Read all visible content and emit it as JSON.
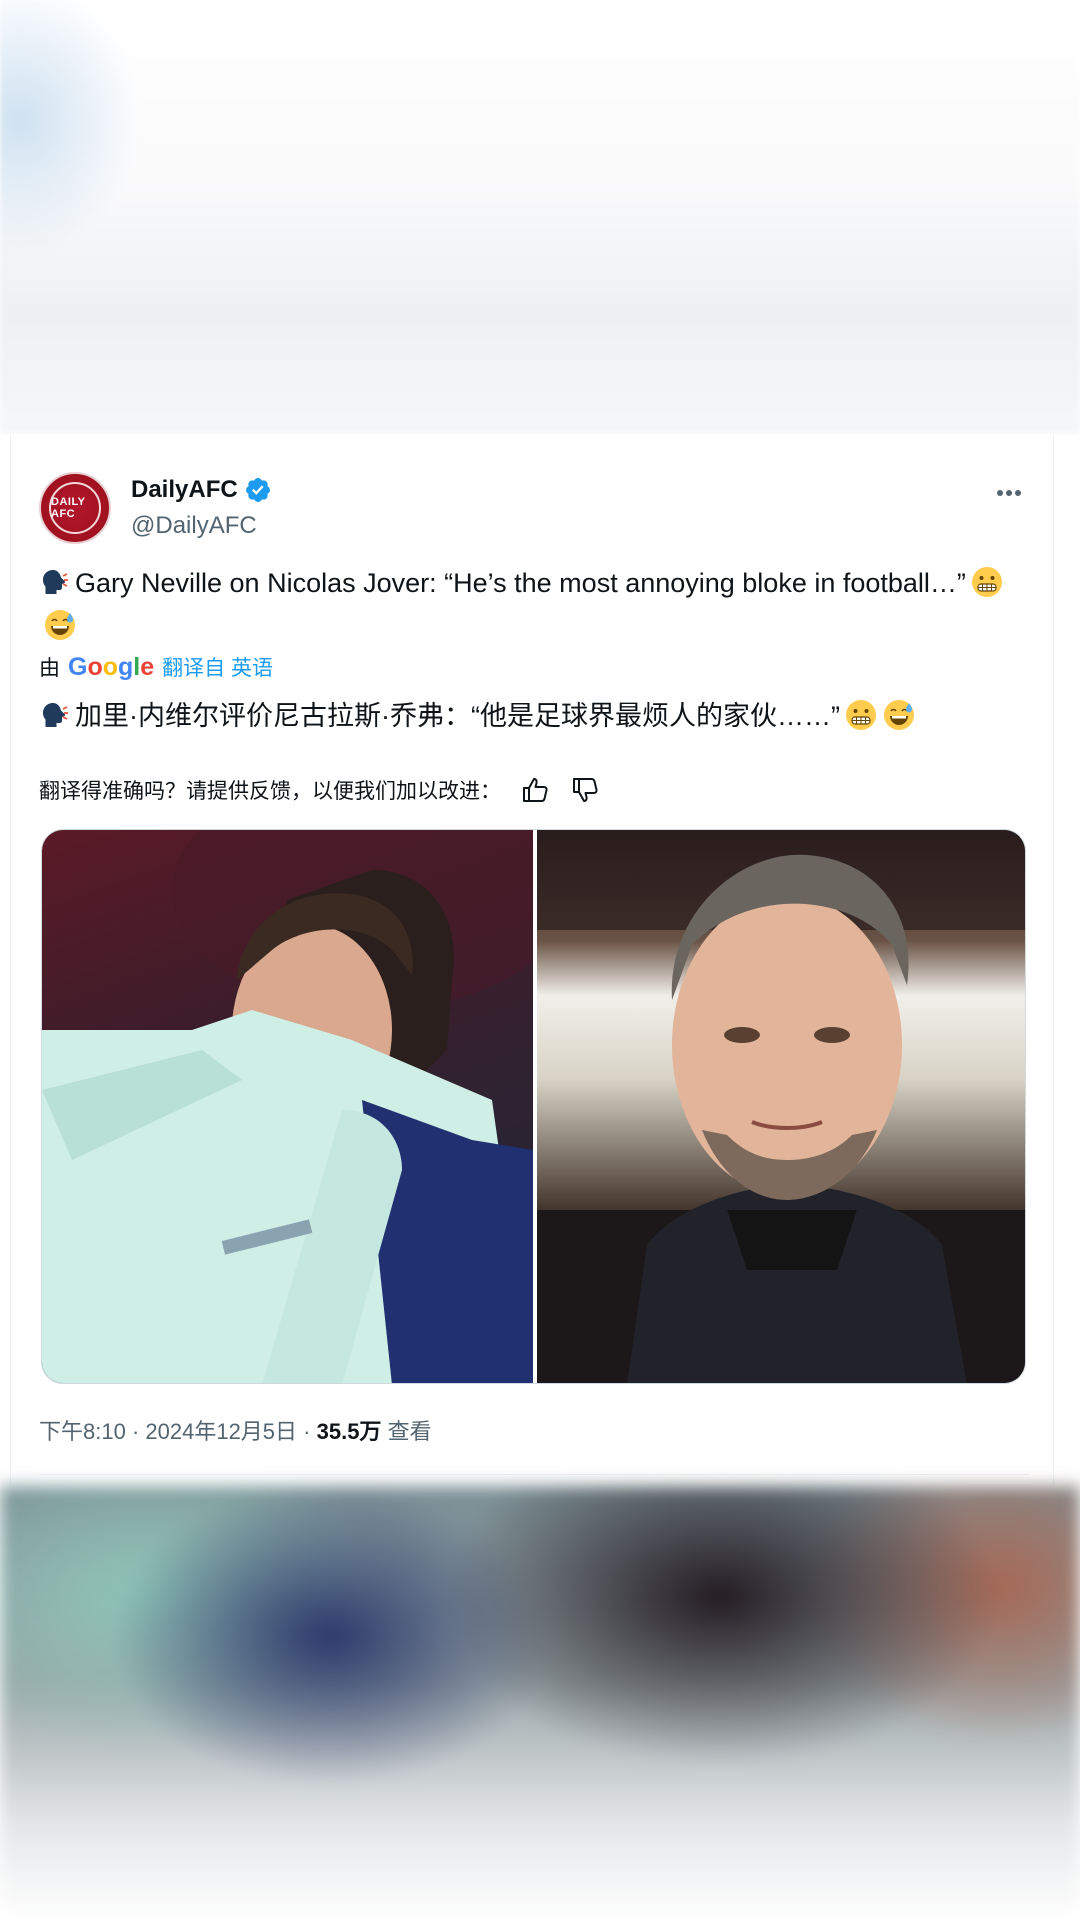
{
  "tweet": {
    "display_name": "DailyAFC",
    "handle": "@DailyAFC",
    "avatar_text": "DAILY AFC",
    "text_main": "Gary Neville on Nicolas Jover: “He’s the most annoying bloke in football…”",
    "translated_prefix": "由",
    "google": [
      "G",
      "o",
      "o",
      "g",
      "l",
      "e"
    ],
    "translate_link": "翻译自 英语",
    "translation_text": "加里·内维尔评价尼古拉斯·乔弗：“他是足球界最烦人的家伙……”",
    "feedback_prompt": "翻译得准确吗？请提供反馈，以便我们加以改进：",
    "time": "下午8:10",
    "date": "2024年12月5日",
    "views_count": "35.5万",
    "views_label": "查看",
    "separator": " · "
  },
  "icons": {
    "verified": "verified-badge-icon",
    "more": "more-options-icon",
    "speaking_head": "speaking-head-icon",
    "grimace": "grimacing-face-icon",
    "sweat": "grinning-sweat-face-icon",
    "thumbs_up": "thumbs-up-icon",
    "thumbs_down": "thumbs-down-icon"
  },
  "colors": {
    "accent": "#1d9bf0",
    "secondary_text": "#536471",
    "avatar_red": "#a0111f"
  }
}
